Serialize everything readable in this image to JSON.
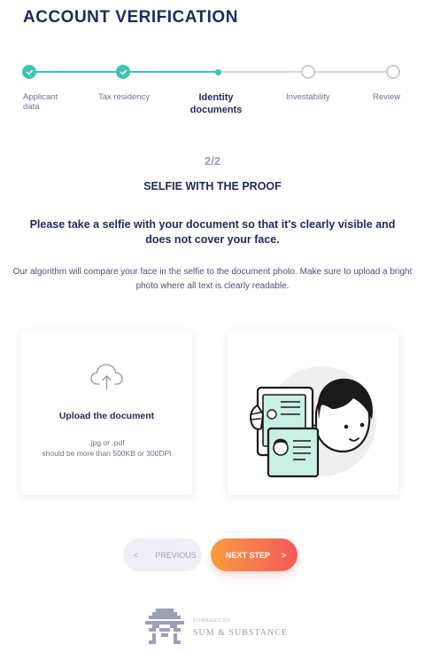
{
  "header": {
    "title": "ACCOUNT VERIFICATION"
  },
  "stepper": {
    "steps": [
      {
        "label": "Applicant data",
        "state": "done"
      },
      {
        "label": "Tax residency",
        "state": "done"
      },
      {
        "label": "Identity documents",
        "state": "current"
      },
      {
        "label": "Investability",
        "state": "todo"
      },
      {
        "label": "Review",
        "state": "todo"
      }
    ]
  },
  "main": {
    "counter": "2/2",
    "subtitle": "SELFIE WITH THE PROOF",
    "instruction": "Please take a selfie with your document so that it's clearly visible and does not cover your face.",
    "description": "Our algorithm will compare your face in the selfie to the document photo. Make sure to upload a bright photo where all text is clearly readable."
  },
  "upload": {
    "icon": "cloud-upload-icon",
    "title": "Upload the document",
    "formats": ".jpg or .pdf",
    "size_hint": "should be more than 500KB or 300DPI"
  },
  "buttons": {
    "previous": "PREVIOUS",
    "previous_arrow": "<",
    "next": "NEXT STEP",
    "next_arrow": ">"
  },
  "footer": {
    "powered_by": "POWERED BY",
    "brand": "SUM & SUBSTANCE"
  },
  "colors": {
    "accent": "#3bc6b3",
    "title": "#1f2a5a",
    "next_gradient_start": "#fb9b3f",
    "next_gradient_end": "#f4595b"
  }
}
